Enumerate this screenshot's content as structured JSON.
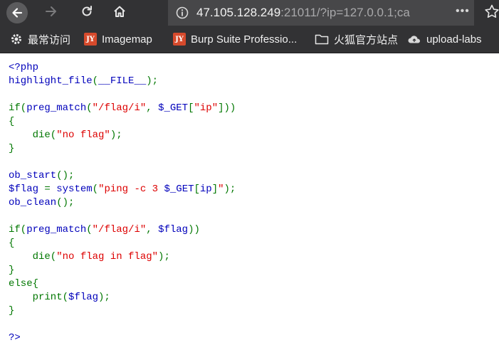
{
  "browser": {
    "url_host": "47.105.128.249",
    "url_rest": ":21011/?ip=127.0.0.1;ca",
    "more_label": "•••",
    "icons": [
      "back-arrow-icon",
      "forward-arrow-icon",
      "reload-icon",
      "home-icon",
      "info-icon",
      "star-icon"
    ]
  },
  "bookmarks": [
    {
      "label": "最常访问",
      "icon": "gear-icon"
    },
    {
      "label": "Imagemap",
      "icon": "jy-logo-icon",
      "badge": "JY"
    },
    {
      "label": "Burp Suite Professio...",
      "icon": "jy-logo-icon",
      "badge": "JY"
    },
    {
      "label": "火狐官方站点",
      "icon": "folder-icon"
    },
    {
      "label": "upload-labs",
      "icon": "cloud-icon"
    }
  ],
  "code": {
    "colors": {
      "keyword": "#007700",
      "default": "#0000bb",
      "string": "#dd0000"
    },
    "lines": [
      [
        [
          "def",
          "<?php"
        ]
      ],
      [
        [
          "def",
          "highlight_file"
        ],
        [
          "kw",
          "("
        ],
        [
          "def",
          "__FILE__"
        ],
        [
          "kw",
          ");"
        ]
      ],
      [],
      [
        [
          "kw",
          "if("
        ],
        [
          "def",
          "preg_match"
        ],
        [
          "kw",
          "("
        ],
        [
          "str",
          "\"/flag/i\""
        ],
        [
          "kw",
          ", "
        ],
        [
          "def",
          "$_GET"
        ],
        [
          "kw",
          "["
        ],
        [
          "str",
          "\"ip\""
        ],
        [
          "kw",
          "]))"
        ]
      ],
      [
        [
          "kw",
          "{"
        ]
      ],
      [
        [
          "kw",
          "    die("
        ],
        [
          "str",
          "\"no flag\""
        ],
        [
          "kw",
          ");"
        ]
      ],
      [
        [
          "kw",
          "}"
        ]
      ],
      [],
      [
        [
          "def",
          "ob_start"
        ],
        [
          "kw",
          "();"
        ]
      ],
      [
        [
          "def",
          "$flag "
        ],
        [
          "kw",
          "= "
        ],
        [
          "def",
          "system"
        ],
        [
          "kw",
          "("
        ],
        [
          "str",
          "\"ping -c 3 "
        ],
        [
          "def",
          "$_GET"
        ],
        [
          "kw",
          "["
        ],
        [
          "def",
          "ip"
        ],
        [
          "kw",
          "]"
        ],
        [
          "str",
          "\""
        ],
        [
          "kw",
          ");"
        ]
      ],
      [
        [
          "def",
          "ob_clean"
        ],
        [
          "kw",
          "();"
        ]
      ],
      [],
      [
        [
          "kw",
          "if("
        ],
        [
          "def",
          "preg_match"
        ],
        [
          "kw",
          "("
        ],
        [
          "str",
          "\"/flag/i\""
        ],
        [
          "kw",
          ", "
        ],
        [
          "def",
          "$flag"
        ],
        [
          "kw",
          "))"
        ]
      ],
      [
        [
          "kw",
          "{"
        ]
      ],
      [
        [
          "kw",
          "    die("
        ],
        [
          "str",
          "\"no flag in flag\""
        ],
        [
          "kw",
          ");"
        ]
      ],
      [
        [
          "kw",
          "}"
        ]
      ],
      [
        [
          "kw",
          "else{"
        ]
      ],
      [
        [
          "kw",
          "    print("
        ],
        [
          "def",
          "$flag"
        ],
        [
          "kw",
          ");"
        ]
      ],
      [
        [
          "kw",
          "}"
        ]
      ],
      [],
      [
        [
          "def",
          "?>"
        ]
      ]
    ]
  }
}
